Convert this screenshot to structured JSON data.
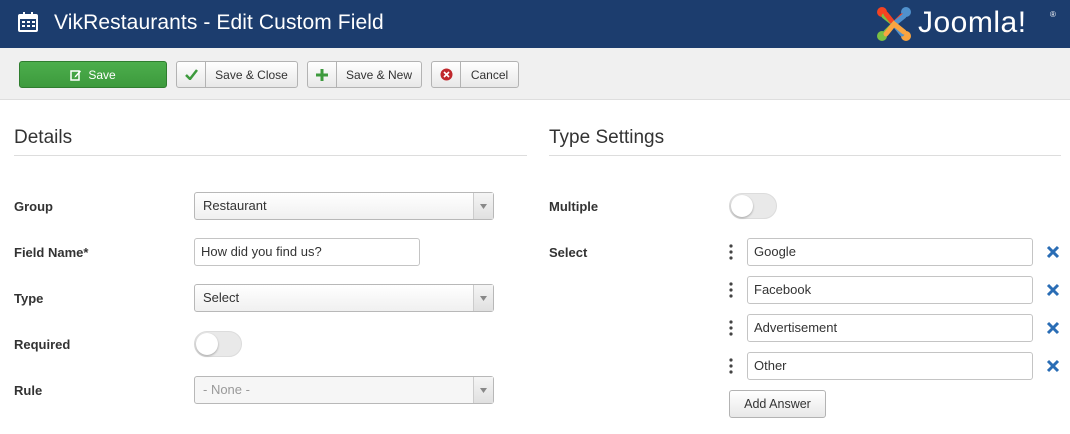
{
  "header": {
    "title": "VikRestaurants - Edit Custom Field",
    "brand": "Joomla!",
    "brand_color": "#1c3d6e"
  },
  "toolbar": {
    "save_label": "Save",
    "save_close_label": "Save & Close",
    "save_new_label": "Save & New",
    "cancel_label": "Cancel",
    "save_color": "#46a546"
  },
  "details": {
    "title": "Details",
    "group_label": "Group",
    "group_value": "Restaurant",
    "field_name_label": "Field Name*",
    "field_name_value": "How did you find us?",
    "type_label": "Type",
    "type_value": "Select",
    "required_label": "Required",
    "required_on": false,
    "rule_label": "Rule",
    "rule_value": "- None -"
  },
  "type_settings": {
    "title": "Type Settings",
    "multiple_label": "Multiple",
    "multiple_on": false,
    "select_label": "Select",
    "answers": [
      "Google",
      "Facebook",
      "Advertisement",
      "Other"
    ],
    "add_answer_label": "Add Answer",
    "remove_color": "#2a6db5"
  }
}
